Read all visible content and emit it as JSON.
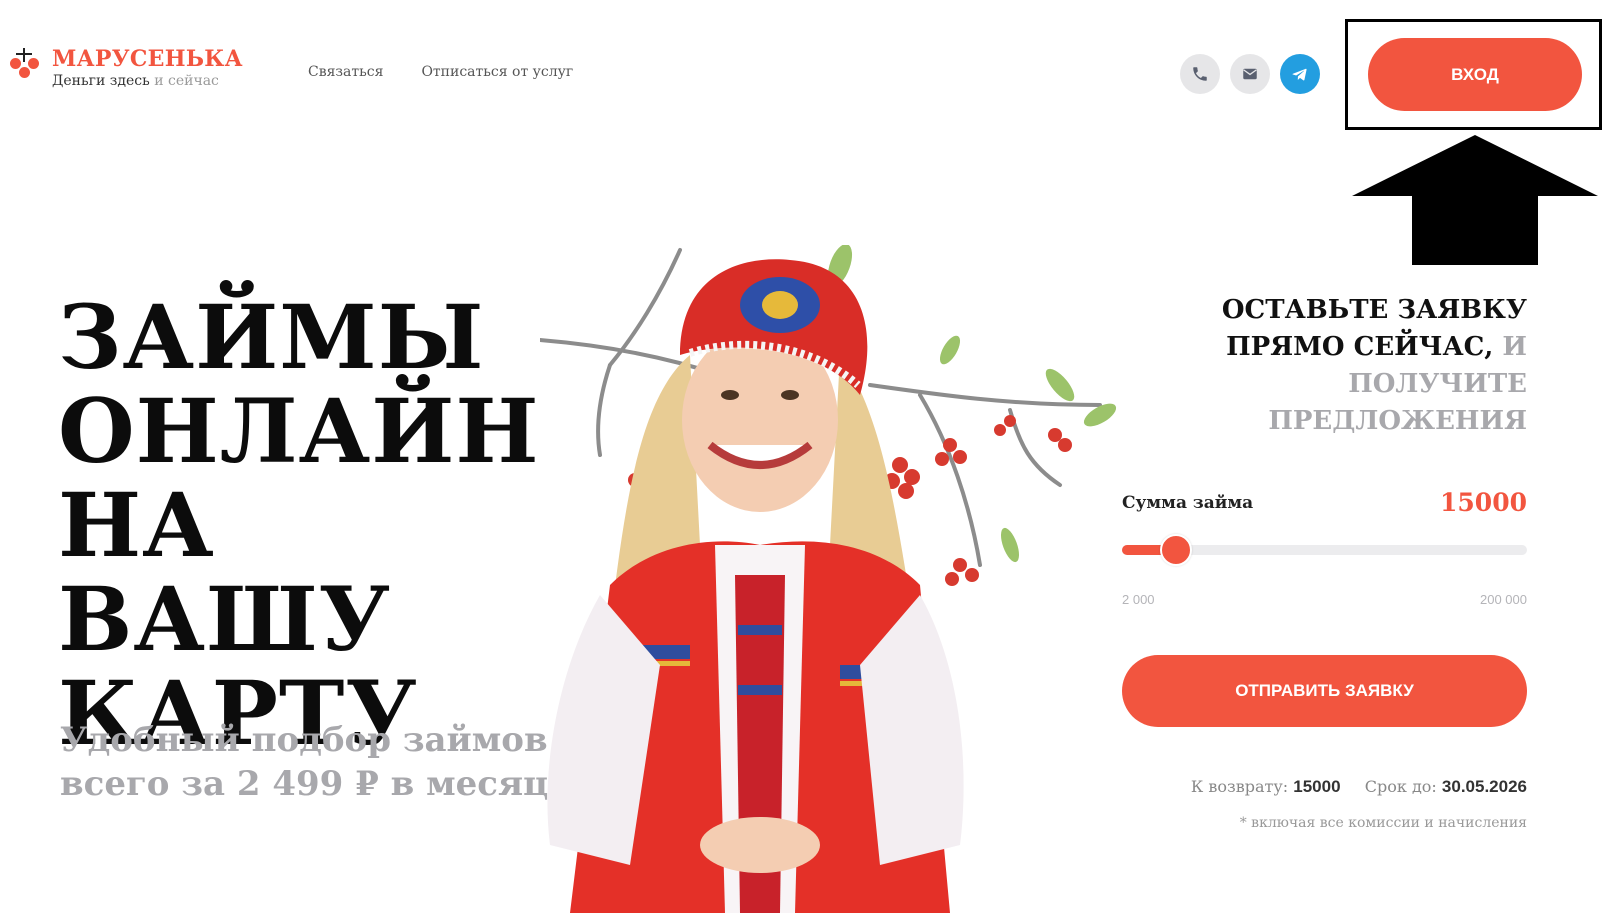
{
  "brand": {
    "name": "МАРУСЕНЬКА",
    "tagline_main": "Деньги здесь",
    "tagline_muted": "и сейчас"
  },
  "nav": {
    "contact": "Связаться",
    "unsubscribe": "Отписаться от услуг"
  },
  "header": {
    "login_label": "ВХОД",
    "icons": [
      "phone-icon",
      "mail-icon",
      "telegram-icon"
    ]
  },
  "hero": {
    "title_lines": [
      "ЗАЙМЫ",
      "ОНЛАЙН",
      "НА ВАШУ",
      "КАРТУ"
    ],
    "subtitle_line1": "Удобный подбор займов",
    "subtitle_line2": "всего за 2 499 ₽ в месяц"
  },
  "form": {
    "title_bold": "ОСТАВЬТЕ ЗАЯВКУ ПРЯМО СЕЙЧАС,",
    "title_muted": "И ПОЛУЧИТЕ ПРЕДЛОЖЕНИЯ",
    "amount_label": "Сумма займа",
    "amount_value": "15000",
    "slider": {
      "min": 2000,
      "max": 200000,
      "value": 15000
    },
    "range_min_label": "2 000",
    "range_max_label": "200 000",
    "submit_label": "ОТПРАВИТЬ ЗАЯВКУ",
    "return_label": "К возврату:",
    "return_value": "15000",
    "term_label": "Срок до:",
    "term_value": "30.05.2026",
    "note": "* включая все комиссии и начисления"
  },
  "colors": {
    "accent": "#f2553f",
    "muted_text": "#a8a8ac",
    "telegram": "#239ee0"
  }
}
